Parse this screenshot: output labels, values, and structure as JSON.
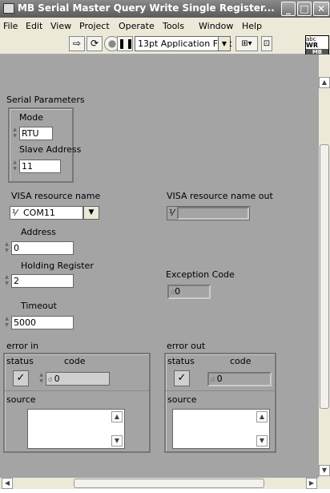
{
  "window": {
    "title": "MB Serial Master Query Write Single Register..."
  },
  "menu": [
    "File",
    "Edit",
    "View",
    "Project",
    "Operate",
    "Tools",
    "Window",
    "Help"
  ],
  "toolbar": {
    "font": "13pt Application Font"
  },
  "logo": {
    "line1": "abc",
    "line2": "WR",
    "line3": "MB"
  },
  "serial_parameters": {
    "title": "Serial Parameters",
    "mode_label": "Mode",
    "mode_value": "RTU",
    "slave_label": "Slave Address",
    "slave_value": "11"
  },
  "visa_in": {
    "label": "VISA resource name",
    "value": "COM11"
  },
  "visa_out": {
    "label": "VISA resource name out",
    "value": ""
  },
  "address": {
    "label": "Address",
    "value": "0"
  },
  "holding": {
    "label": "Holding Register",
    "value": "2"
  },
  "exception": {
    "label": "Exception Code",
    "value": "0"
  },
  "timeout": {
    "label": "Timeout",
    "value": "5000"
  },
  "error_in": {
    "label": "error in",
    "status_label": "status",
    "code_label": "code",
    "code_value": "0",
    "source_label": "source"
  },
  "error_out": {
    "label": "error out",
    "status_label": "status",
    "code_label": "code",
    "code_value": "0",
    "source_label": "source"
  }
}
